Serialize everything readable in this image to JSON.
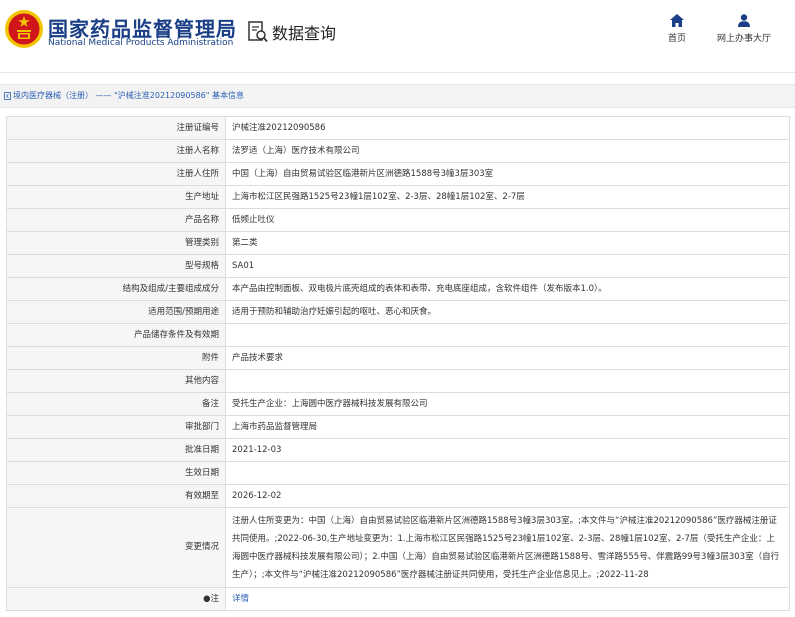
{
  "header": {
    "logo_cn": "国家药品监督管理局",
    "logo_en": "National Medical Products Administration",
    "emblem_icon": "national-emblem",
    "query_icon": "document-search-icon",
    "query_title": "数据查询",
    "nav": [
      {
        "label": "首页",
        "icon": "home-icon"
      },
      {
        "label": "网上办事大厅",
        "icon": "user-icon"
      }
    ]
  },
  "breadcrumb": {
    "category": "境内医疗器械（注册）",
    "separator": "——",
    "record": "\"沪械注准20212090586\"",
    "page": "基本信息"
  },
  "rows": [
    {
      "label": "注册证编号",
      "value": "沪械注准20212090586"
    },
    {
      "label": "注册人名称",
      "value": "法罗适（上海）医疗技术有限公司"
    },
    {
      "label": "注册人住所",
      "value": "中国（上海）自由贸易试验区临港新片区洲德路1588号3幢3层303室"
    },
    {
      "label": "生产地址",
      "value": "上海市松江区民强路1525号23幢1层102室、2-3层、28幢1层102室、2-7层"
    },
    {
      "label": "产品名称",
      "value": "低频止吐仪"
    },
    {
      "label": "管理类别",
      "value": "第二类"
    },
    {
      "label": "型号规格",
      "value": "SA01"
    },
    {
      "label": "结构及组成/主要组成成分",
      "value": "本产品由控制面板、双电极片底壳组成的表体和表带、充电底座组成，含软件组件（发布版本1.0）。"
    },
    {
      "label": "适用范围/预期用途",
      "value": "适用于预防和辅助治疗妊娠引起的呕吐、恶心和厌食。"
    },
    {
      "label": "产品储存条件及有效期",
      "value": ""
    },
    {
      "label": "附件",
      "value": "产品技术要求"
    },
    {
      "label": "其他内容",
      "value": ""
    },
    {
      "label": "备注",
      "value": "受托生产企业：上海圆中医疗器械科技发展有限公司"
    },
    {
      "label": "审批部门",
      "value": "上海市药品监督管理局"
    },
    {
      "label": "批准日期",
      "value": "2021-12-03"
    },
    {
      "label": "生效日期",
      "value": ""
    },
    {
      "label": "有效期至",
      "value": "2026-12-02"
    },
    {
      "label": "变更情况",
      "value": "注册人住所变更为：中国（上海）自由贸易试验区临港新片区洲德路1588号3幢3层303室。;本文件与“沪械注准20212090586”医疗器械注册证共同使用。;2022-06-30,生产地址变更为：1.上海市松江区民强路1525号23幢1层102室、2-3层、28幢1层102室、2-7层（受托生产企业：上海圆中医疗器械科技发展有限公司）；2.中国（上海）自由贸易试验区临港新片区洲德路1588号、雪洋路555号、伴震路99号3幢3层303室（自行生产）；;本文件与“沪械注准20212090586”医疗器械注册证共同使用，受托生产企业信息见上。;2022-11-28"
    }
  ],
  "note": {
    "label": "●注",
    "link": "详情"
  },
  "colors": {
    "brand_blue": "#1a3f86",
    "link_blue": "#2a5fb3",
    "emblem_red": "#d0161b",
    "emblem_gold": "#f3c400"
  }
}
